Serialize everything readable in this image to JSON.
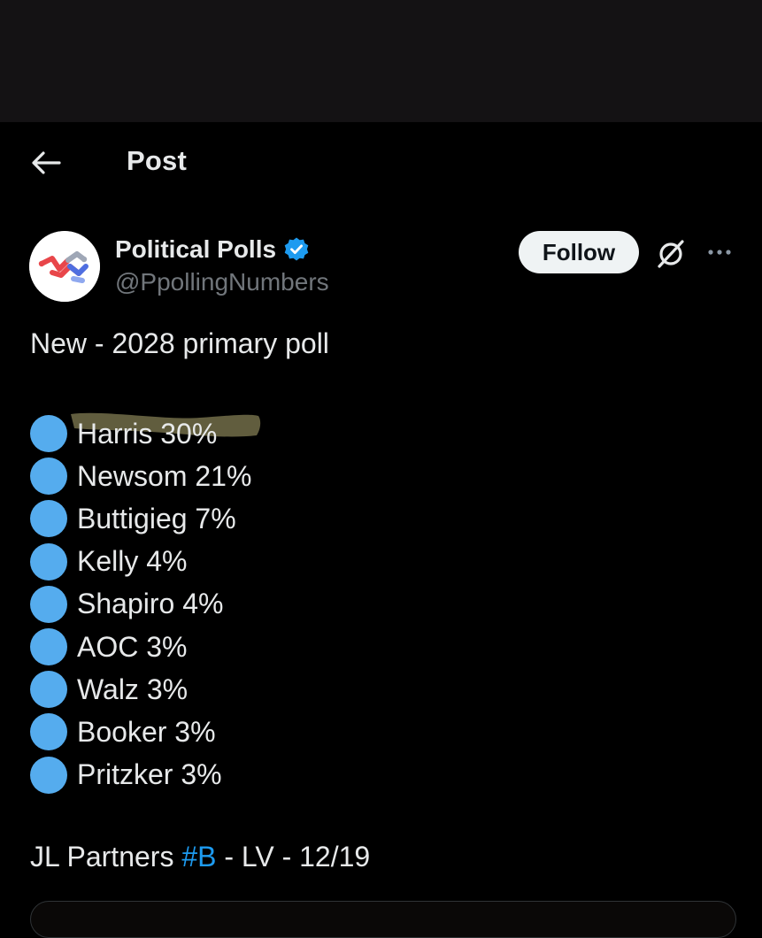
{
  "header": {
    "title": "Post",
    "back_icon": "arrow-left-icon"
  },
  "author": {
    "display_name": "Political Polls",
    "handle": "@PpollingNumbers",
    "verified": true,
    "verified_color": "#1d9bf0"
  },
  "actions": {
    "follow_label": "Follow",
    "grok_icon": "grok-icon",
    "more_icon": "more-horizontal-icon"
  },
  "post": {
    "intro": "New - 2028 primary poll",
    "bullet_color": "#55acee",
    "highlight_color": "#fff4a3",
    "items": [
      {
        "text": "Harris 30%",
        "highlighted": true
      },
      {
        "text": "Newsom 21%"
      },
      {
        "text": "Buttigieg 7%"
      },
      {
        "text": "Kelly 4%"
      },
      {
        "text": "Shapiro 4%"
      },
      {
        "text": "AOC 3%"
      },
      {
        "text": "Walz 3%"
      },
      {
        "text": "Booker 3%"
      },
      {
        "text": "Pritzker 3%"
      }
    ],
    "source_prefix": "JL Partners ",
    "hashtag": "#B",
    "source_suffix": " - LV - 12/19"
  }
}
